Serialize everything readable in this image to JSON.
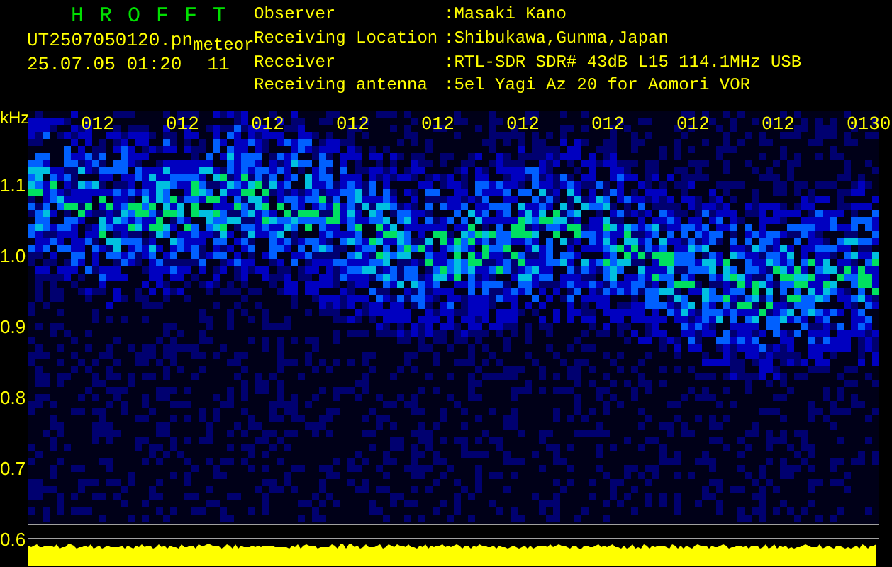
{
  "header": {
    "title": "H R O F F T",
    "file_name": "UT2507050120.pn",
    "file_suffix": "meteor",
    "date_time": "25.07.05 01:20",
    "count": "11"
  },
  "info": [
    {
      "label": "Observer",
      "value": ":Masaki Kano"
    },
    {
      "label": "Receiving Location",
      "value": ":Shibukawa,Gunma,Japan"
    },
    {
      "label": "Receiver",
      "value": ":RTL-SDR SDR# 43dB L15 114.1MHz USB"
    },
    {
      "label": "Receiving antenna",
      "value": ":5el Yagi Az 20 for Aomori VOR"
    }
  ],
  "plot": {
    "unit": "kHz",
    "y_labels": [
      "1.1",
      "1.0",
      "0.9",
      "0.8",
      "0.7",
      "0.6"
    ],
    "time_labels": [
      "012",
      "012",
      "012",
      "012",
      "012",
      "012",
      "012",
      "012",
      "012",
      "0130"
    ]
  }
}
